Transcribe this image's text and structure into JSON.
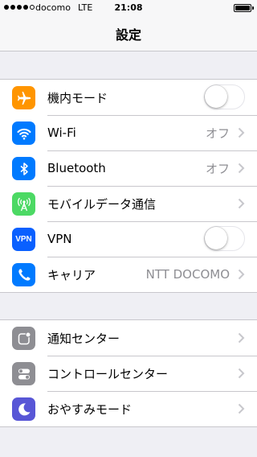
{
  "status_bar": {
    "carrier": "docomo",
    "network": "LTE",
    "time": "21:08",
    "signal_strength": 4,
    "signal_max": 5,
    "battery_level": 1.0
  },
  "nav": {
    "title": "設定"
  },
  "groups": [
    {
      "rows": [
        {
          "label": "機内モード",
          "icon": "airplane-icon",
          "icon_color": "#ff9500",
          "accessory": "toggle",
          "toggle_on": false
        },
        {
          "label": "Wi-Fi",
          "icon": "wifi-icon",
          "icon_color": "#007aff",
          "value": "オフ",
          "accessory": "chevron"
        },
        {
          "label": "Bluetooth",
          "icon": "bluetooth-icon",
          "icon_color": "#007aff",
          "value": "オフ",
          "accessory": "chevron"
        },
        {
          "label": "モバイルデータ通信",
          "icon": "antenna-icon",
          "icon_color": "#4cd964",
          "accessory": "chevron"
        },
        {
          "label": "VPN",
          "icon": "vpn-icon",
          "icon_text": "VPN",
          "icon_color": "#0a60ff",
          "accessory": "toggle",
          "toggle_on": false
        },
        {
          "label": "キャリア",
          "icon": "phone-icon",
          "icon_color": "#007aff",
          "value": "NTT DOCOMO",
          "accessory": "chevron"
        }
      ]
    },
    {
      "rows": [
        {
          "label": "通知センター",
          "icon": "notification-center-icon",
          "icon_color": "#8e8e93",
          "accessory": "chevron"
        },
        {
          "label": "コントロールセンター",
          "icon": "control-center-icon",
          "icon_color": "#8e8e93",
          "accessory": "chevron"
        },
        {
          "label": "おやすみモード",
          "icon": "moon-icon",
          "icon_color": "#5856d6",
          "accessory": "chevron"
        }
      ]
    }
  ]
}
